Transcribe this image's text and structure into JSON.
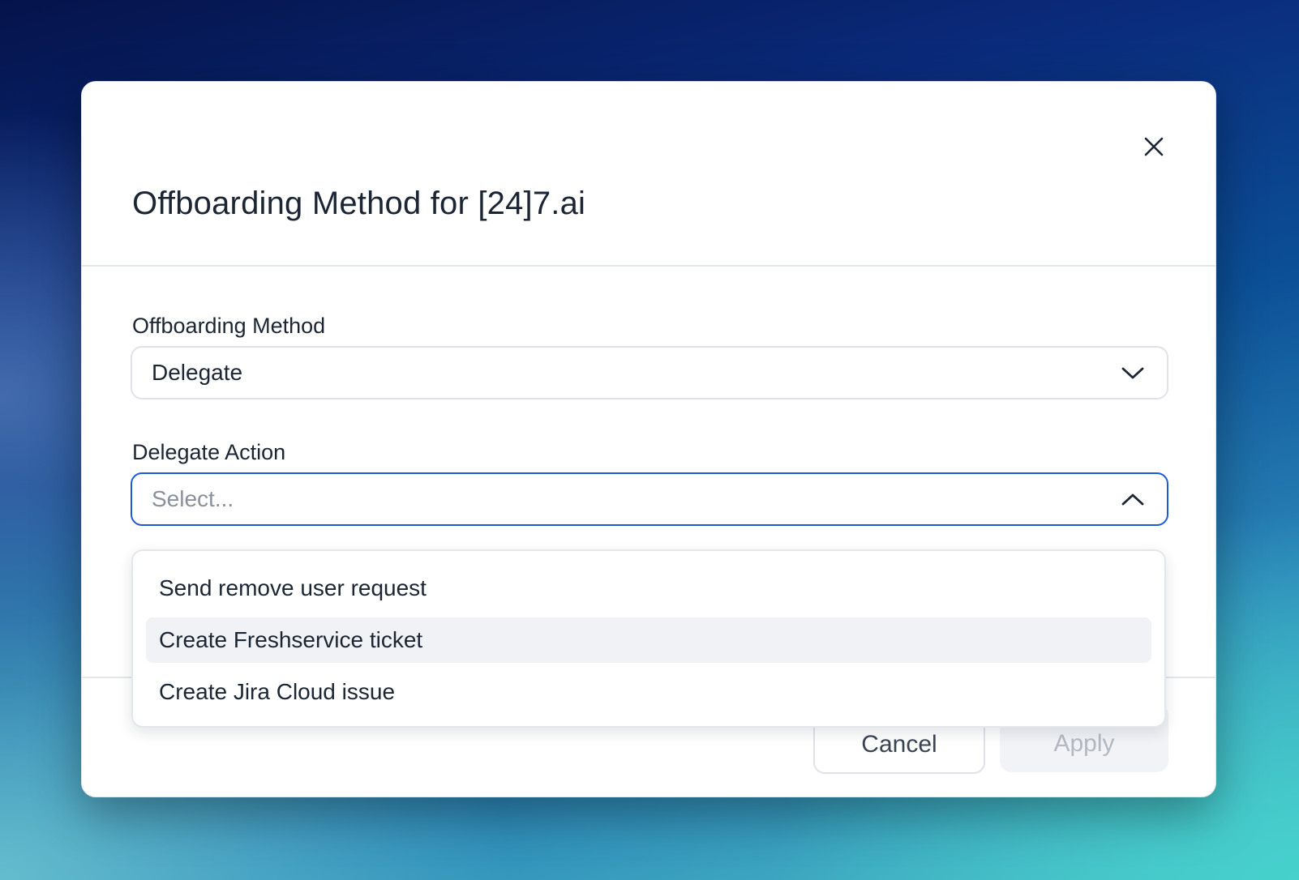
{
  "modal": {
    "title": "Offboarding Method for [24]7.ai",
    "close_icon": "close-icon"
  },
  "offboarding_method": {
    "label": "Offboarding Method",
    "value": "Delegate",
    "icon": "chevron-down-icon"
  },
  "delegate_action": {
    "label": "Delegate Action",
    "placeholder": "Select...",
    "icon": "chevron-up-icon",
    "expanded": true,
    "options": [
      {
        "label": "Send remove user request"
      },
      {
        "label": "Create Freshservice ticket",
        "highlighted": true
      },
      {
        "label": "Create Jira Cloud issue"
      }
    ]
  },
  "footer": {
    "cancel_label": "Cancel",
    "apply_label": "Apply",
    "apply_disabled": true
  },
  "colors": {
    "accent_border": "#1d5ad8",
    "text_primary": "#1b2533",
    "placeholder": "#8a919c",
    "highlight_bg": "#f1f2f5"
  }
}
